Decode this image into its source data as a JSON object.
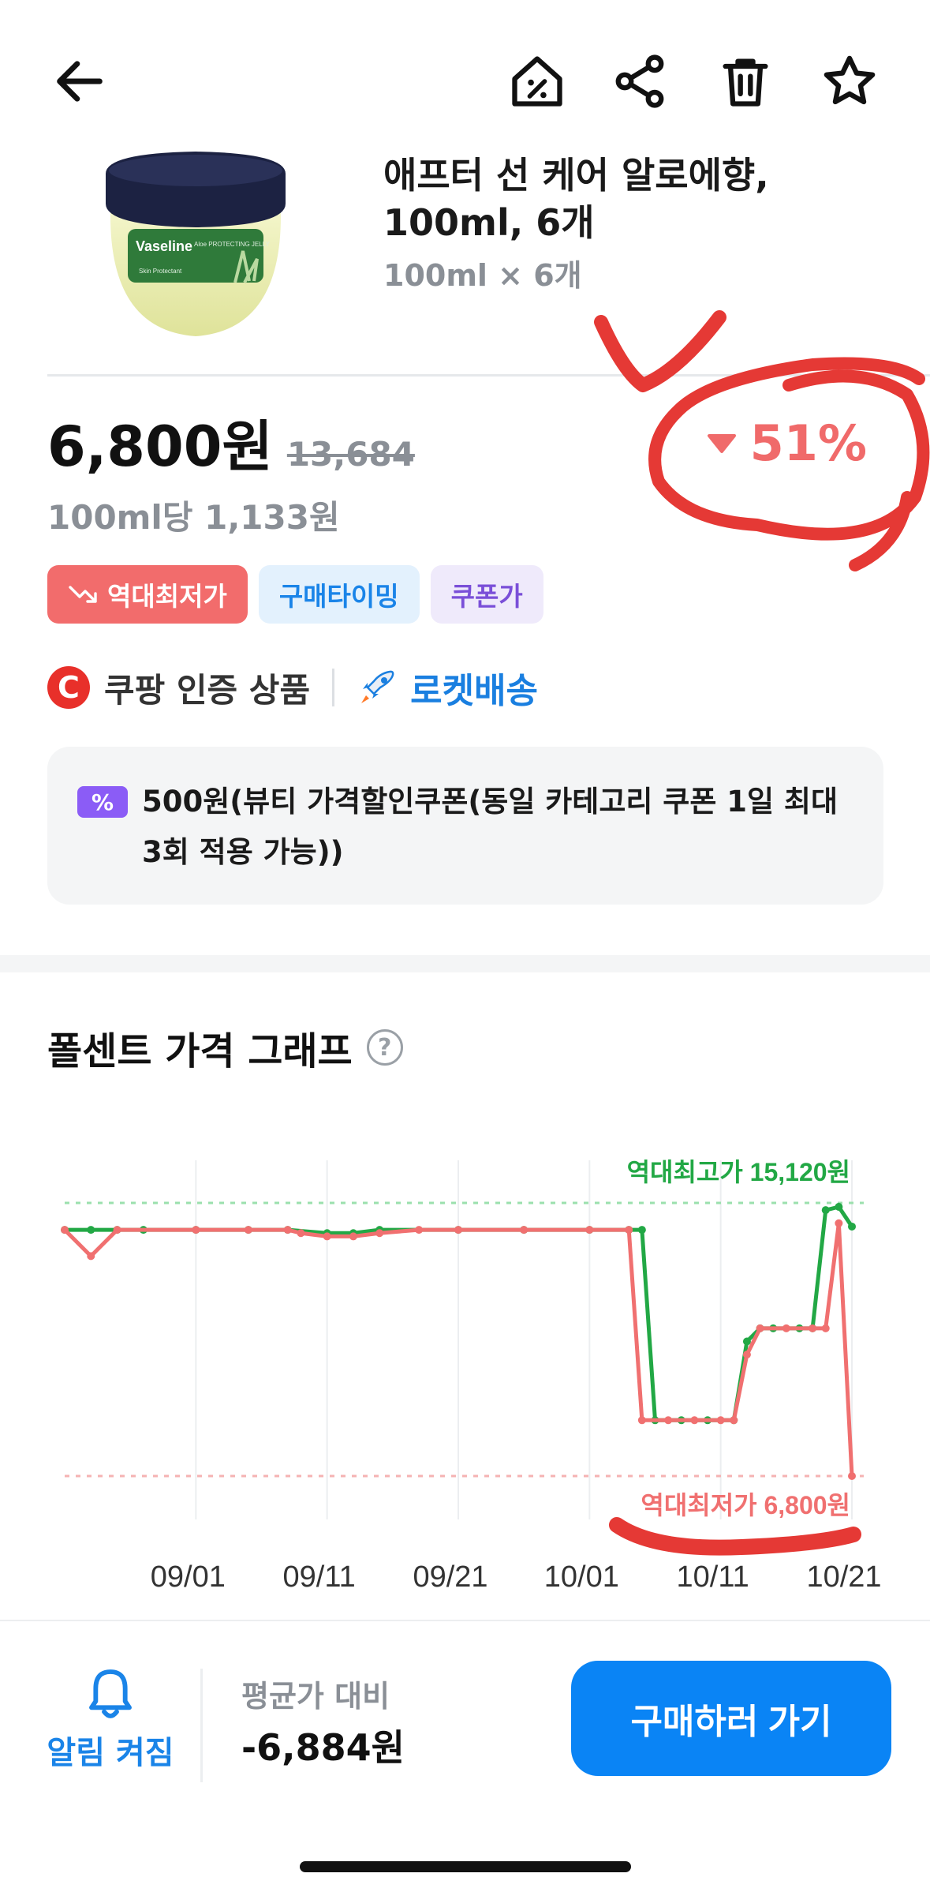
{
  "product": {
    "name": "애프터 선 케어 알로에향, 100ml, 6개",
    "option": "100ml × 6개",
    "image_label": "Vaseline",
    "image_sub": "Aloe PROTECTING JELLY",
    "image_tag": "Skin Protectant"
  },
  "price": {
    "current": "6,800원",
    "original": "13,684",
    "discount": "51%",
    "per_unit": "100ml당 1,133원"
  },
  "tags": [
    {
      "label": "역대최저가",
      "color": "#f26c6c"
    },
    {
      "label": "구매타이밍",
      "color": "#1a84e8"
    },
    {
      "label": "쿠폰가",
      "color": "#7a4fd8"
    }
  ],
  "certs": {
    "c_letter": "C",
    "coupang": "쿠팡 인증 상품",
    "rocket": "로켓배송"
  },
  "coupon": {
    "icon": "%",
    "text": "500원(뷰티 가격할인쿠폰(동일 카테고리 쿠폰 1일 최대 3회 적용 가능))"
  },
  "graph": {
    "title": "폴센트 가격 그래프",
    "help": "?"
  },
  "chart_data": {
    "type": "line",
    "x_ticks": [
      "09/01",
      "09/11",
      "09/21",
      "10/01",
      "10/11",
      "10/21"
    ],
    "annotations": {
      "max_label": "역대최고가 15,120원",
      "min_label": "역대최저가 6,800원",
      "max_value": 15120,
      "min_value": 6800
    },
    "ylim": [
      6000,
      16000
    ],
    "series": [
      {
        "color": "#22a845",
        "points": [
          [
            "08/22",
            14300
          ],
          [
            "08/24",
            14300
          ],
          [
            "08/26",
            14300
          ],
          [
            "08/28",
            14300
          ],
          [
            "09/01",
            14300
          ],
          [
            "09/05",
            14300
          ],
          [
            "09/08",
            14300
          ],
          [
            "09/11",
            14200
          ],
          [
            "09/13",
            14200
          ],
          [
            "09/15",
            14300
          ],
          [
            "09/21",
            14300
          ],
          [
            "09/26",
            14300
          ],
          [
            "10/01",
            14300
          ],
          [
            "10/04",
            14300
          ],
          [
            "10/05",
            14300
          ],
          [
            "10/06",
            8500
          ],
          [
            "10/08",
            8500
          ],
          [
            "10/10",
            8500
          ],
          [
            "10/12",
            8500
          ],
          [
            "10/13",
            10900
          ],
          [
            "10/14",
            11300
          ],
          [
            "10/15",
            11300
          ],
          [
            "10/17",
            11300
          ],
          [
            "10/18",
            11300
          ],
          [
            "10/19",
            14900
          ],
          [
            "10/20",
            15000
          ],
          [
            "10/21",
            14400
          ]
        ]
      },
      {
        "color": "#f07070",
        "points": [
          [
            "08/22",
            14300
          ],
          [
            "08/24",
            13500
          ],
          [
            "08/26",
            14300
          ],
          [
            "09/01",
            14300
          ],
          [
            "09/05",
            14300
          ],
          [
            "09/08",
            14300
          ],
          [
            "09/09",
            14200
          ],
          [
            "09/11",
            14100
          ],
          [
            "09/13",
            14100
          ],
          [
            "09/15",
            14200
          ],
          [
            "09/18",
            14300
          ],
          [
            "09/21",
            14300
          ],
          [
            "09/26",
            14300
          ],
          [
            "10/01",
            14300
          ],
          [
            "10/04",
            14300
          ],
          [
            "10/05",
            8500
          ],
          [
            "10/07",
            8500
          ],
          [
            "10/09",
            8500
          ],
          [
            "10/11",
            8500
          ],
          [
            "10/12",
            8500
          ],
          [
            "10/13",
            10500
          ],
          [
            "10/14",
            11300
          ],
          [
            "10/16",
            11300
          ],
          [
            "10/18",
            11300
          ],
          [
            "10/19",
            11300
          ],
          [
            "10/20",
            14500
          ],
          [
            "10/21",
            6800
          ]
        ]
      }
    ]
  },
  "bottom": {
    "alarm_label": "알림 켜짐",
    "avg_label": "평균가 대비",
    "avg_value": "-6,884원",
    "buy_label": "구매하러 가기"
  },
  "colors": {
    "accent_blue": "#0a84f5",
    "discount_red": "#f06a6a",
    "annotation_red": "#e53935"
  }
}
